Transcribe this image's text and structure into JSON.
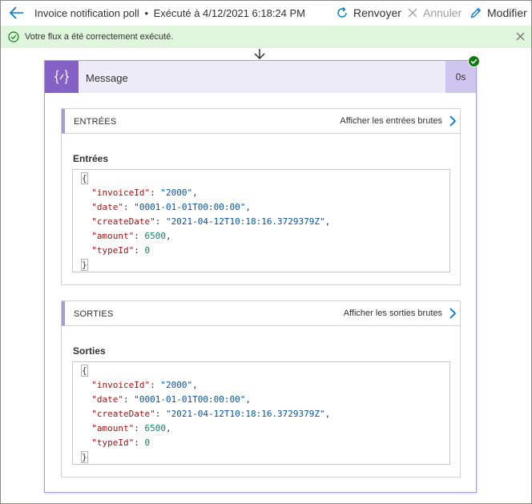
{
  "header": {
    "flow_name": "Invoice notification poll",
    "separator": "•",
    "run_info": "Exécuté à 4/12/2021 6:18:24 PM",
    "resubmit_label": "Renvoyer",
    "cancel_label": "Annuler",
    "edit_label": "Modifier"
  },
  "banner": {
    "message": "Votre flux a été correctement exécuté."
  },
  "action": {
    "title": "Message",
    "duration": "0s",
    "inputs": {
      "section_title": "ENTRÉES",
      "raw_link": "Afficher les entrées brutes",
      "label": "Entrées",
      "json": {
        "invoiceId": "\"2000\"",
        "date": "\"0001-01-01T00:00:00\"",
        "createDate": "\"2021-04-12T10:18:16.3729379Z\"",
        "amount": "6500",
        "typeId": "0"
      }
    },
    "outputs": {
      "section_title": "SORTIES",
      "raw_link": "Afficher les sorties brutes",
      "label": "Sorties",
      "json": {
        "invoiceId": "\"2000\"",
        "date": "\"0001-01-01T00:00:00\"",
        "createDate": "\"2021-04-12T10:18:16.3729379Z\"",
        "amount": "6500",
        "typeId": "0"
      }
    }
  },
  "colors": {
    "accent": "#0078d4",
    "action_purple": "#8661c5",
    "success_green": "#107c10",
    "banner_bg": "#dff6dd"
  },
  "icons": {
    "back": "back-arrow-icon",
    "resubmit": "refresh-icon",
    "cancel": "close-icon",
    "edit": "pencil-icon",
    "success": "check-circle-icon",
    "action": "braces-icon"
  }
}
